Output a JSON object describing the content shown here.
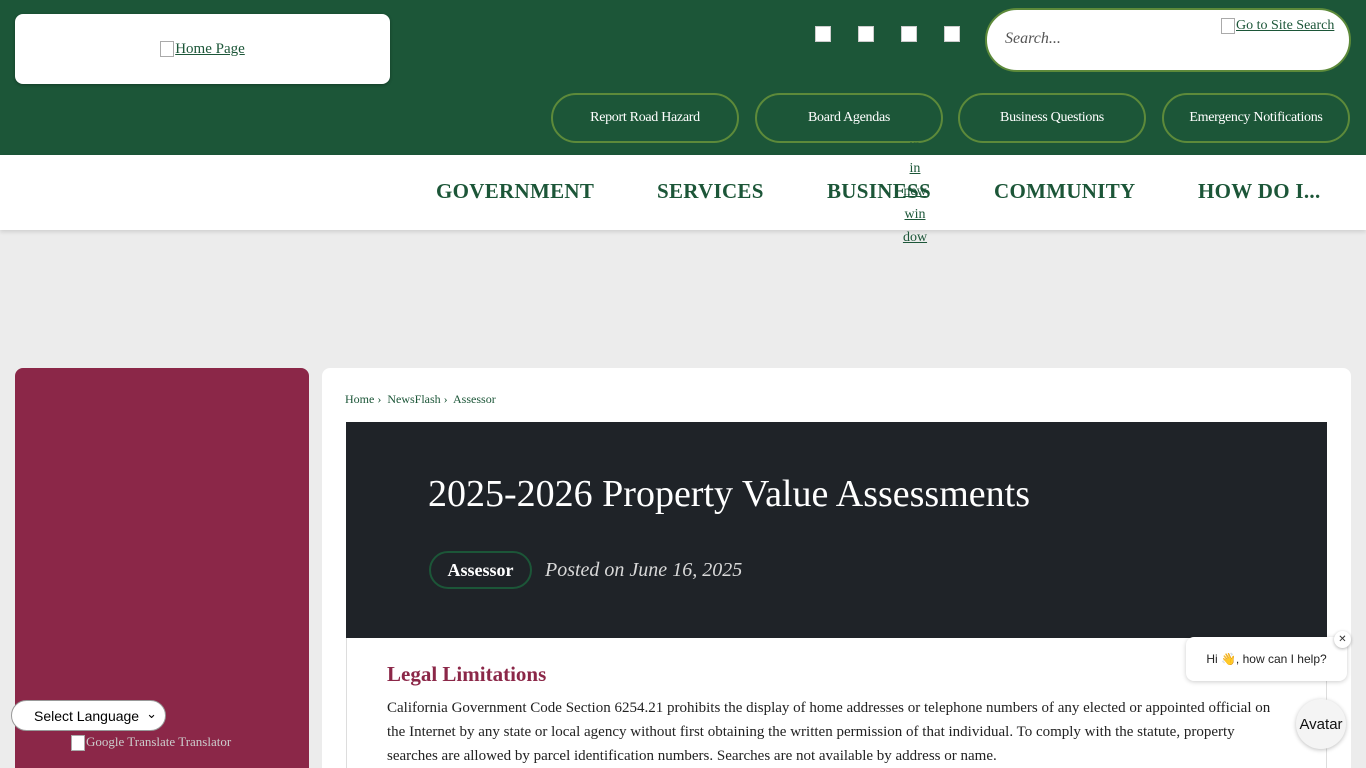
{
  "header": {
    "logo_alt": "Home Page",
    "search": {
      "placeholder": "Search...",
      "button_alt": "Go to Site Search"
    },
    "social_icons": [
      "facebook-icon",
      "twitter-icon",
      "instagram-icon",
      "youtube-icon"
    ],
    "quick_links": [
      "Report Road Hazard",
      "Board Agendas",
      "Business Questions",
      "Emergency Notifications"
    ]
  },
  "nav": {
    "items": [
      "GOVERNMENT",
      "SERVICES",
      "BUSINESS",
      "COMMUNITY",
      "HOW DO I..."
    ],
    "opens_new_window_lines": [
      "in",
      "in",
      "new",
      "win",
      "dow"
    ]
  },
  "breadcrumb": [
    "Home",
    "NewsFlash",
    "Assessor"
  ],
  "article": {
    "title": "2025-2026 Property Value Assessments",
    "category": "Assessor",
    "posted": "Posted on June 16, 2025",
    "section_heading": "Legal Limitations",
    "paragraph": "California Government Code Section 6254.21 prohibits the display of home addresses or telephone numbers of any elected or appointed official on the Internet by any state or local agency without first obtaining the written permission of that individual. To comply with the statute, property searches are allowed by parcel identification numbers. Searches are not available by address or name."
  },
  "language": {
    "selected": "Select Language",
    "powered_alt": "Google Translate Translator"
  },
  "chat": {
    "greeting": "Hi 👋, how can I help?",
    "close": "✕",
    "avatar_label": "Avatar"
  },
  "colors": {
    "brand_green": "#1c5638",
    "accent_maroon": "#8b2748",
    "hero_dark": "#1f2328"
  }
}
